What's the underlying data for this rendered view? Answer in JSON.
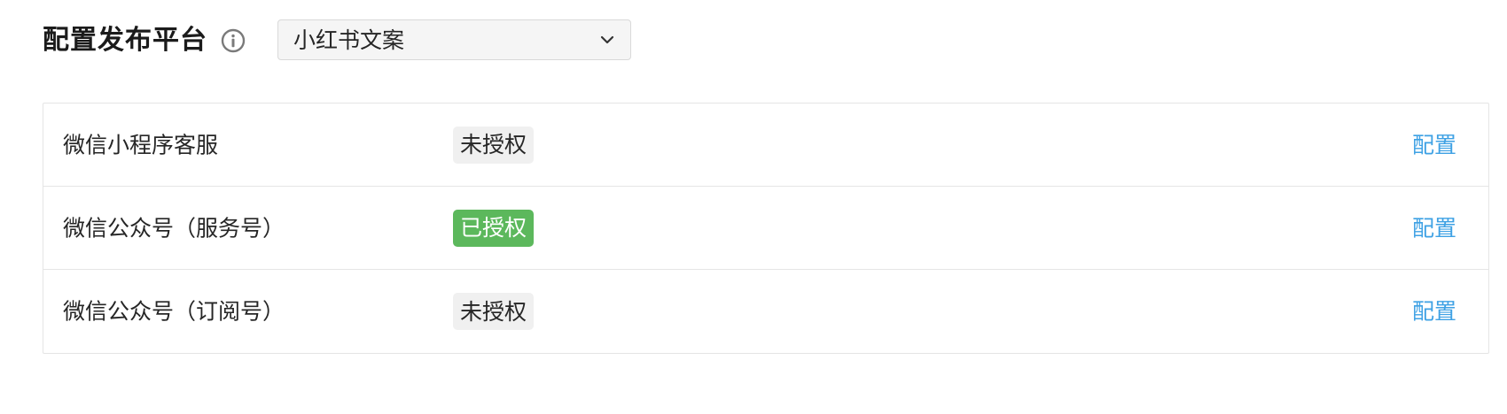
{
  "header": {
    "title": "配置发布平台"
  },
  "platform_select": {
    "value": "小红书文案"
  },
  "channels": [
    {
      "name": "微信小程序客服",
      "status": "未授权",
      "authorized": false,
      "action": "配置"
    },
    {
      "name": "微信公众号（服务号）",
      "status": "已授权",
      "authorized": true,
      "action": "配置"
    },
    {
      "name": "微信公众号（订阅号）",
      "status": "未授权",
      "authorized": false,
      "action": "配置"
    }
  ],
  "colors": {
    "link": "#3ea1e4",
    "authorized_badge": "#5cb85c",
    "unauthorized_badge": "#f0f0f0",
    "border": "#e5e5e5",
    "icon": "#7a7a7a"
  },
  "icons": {
    "info": "info-icon",
    "dropdown": "chevron-down-icon"
  }
}
